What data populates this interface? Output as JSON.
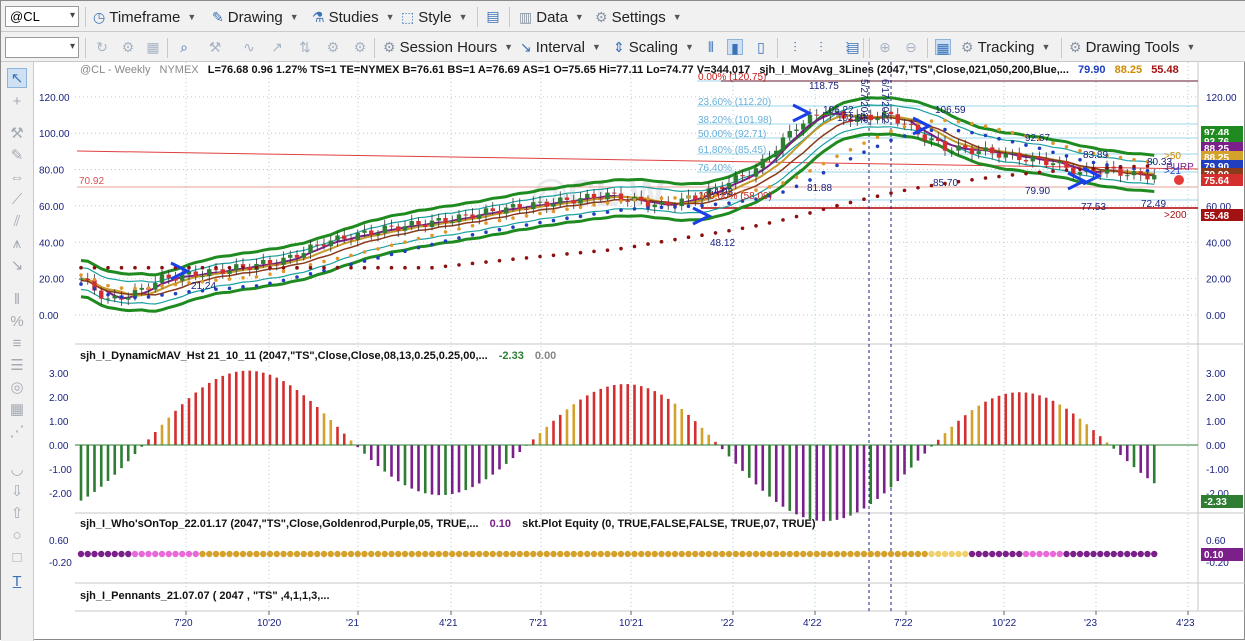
{
  "toolbar": {
    "symbol": "@CL",
    "timeframe": "Timeframe",
    "drawing": "Drawing",
    "studies": "Studies",
    "style": "Style",
    "data": "Data",
    "settings": "Settings",
    "session_hours": "Session Hours",
    "interval": "Interval",
    "scaling": "Scaling",
    "tracking": "Tracking",
    "drawing_tools": "Drawing Tools"
  },
  "chart": {
    "header_symbol": "@CL - Weekly",
    "header_exchange": "NYMEX",
    "header_quote": "L=76.68  0.96  1.27%  TS=1  TE=NYMEX  B=76.61  BS=1  A=76.69  AS=1  O=75.65  Hi=77.11  Lo=74.77  V=344,017",
    "header_study": "sjh_I_MovAvg_3Lines (2047,\"TS\",Close,021,050,200,Blue,...",
    "header_v1": "79.90",
    "header_v2": "88.25",
    "header_v3": "55.48",
    "watermark": "@CL W",
    "price_label_left": "70.92",
    "y_ticks": [
      "120.00",
      "100.00",
      "80.00",
      "60.00",
      "40.00",
      "20.00",
      "0.00"
    ],
    "price_marks": [
      "118.75",
      "106.22",
      "102.91",
      "106.59",
      "92.67",
      "85.70",
      "79.90",
      "83.89",
      "80.33",
      "72.49",
      "77.53",
      "64.93",
      "81.88",
      "48.12",
      "21.24",
      "97.48",
      "93.76",
      "88.25",
      "79.90",
      "75.64",
      "55.48"
    ],
    "fib_labels": [
      "0.00% (120.75)",
      "23.60% (112.20)",
      "38.20% (101.98)",
      "50.00% (92.71)",
      "61.80% (85.45)",
      "76.40%",
      "100.00% (58.09)"
    ],
    "ma_tags": [
      ">50",
      "PURP",
      ">21",
      ">200"
    ],
    "vertical_dates": [
      "5/27/2022",
      "6/17/2022"
    ]
  },
  "panels": {
    "p2_title": "sjh_I_DynamicMAV_Hst 21_10_11 (2047,\"TS\",Close,Close,08,13,0.25,0.25,00,...",
    "p2_v1": "-2.33",
    "p2_v2": "0.00",
    "p2_ticks": [
      "3.00",
      "2.00",
      "1.00",
      "0.00",
      "-1.00",
      "-2.00"
    ],
    "p2_badge": "-2.33",
    "p3_title": "sjh_I_Who'sOnTop_22.01.17 (2047,\"TS\",Close,Goldenrod,Purple,05, TRUE,...",
    "p3_v1": "0.10",
    "p3_study": "skt.Plot Equity (0, TRUE,FALSE,FALSE, TRUE,07, TRUE)",
    "p3_ticks": [
      "0.60",
      "-0.20"
    ],
    "p3_badge": "0.10",
    "p4_title": "sjh_I_Pennants_21.07.07 ( 2047 , \"TS\" ,4,1,1,3,..."
  },
  "xaxis": {
    "labels": [
      "7'20",
      "10'20",
      "'21",
      "4'21",
      "7'21",
      "10'21",
      "'22",
      "4'22",
      "7'22",
      "10'22",
      "'23",
      "4'23"
    ]
  },
  "colors": {
    "accent": "#3a72b8",
    "up": "#2e7d32",
    "down": "#d32f2f",
    "gold": "#d4a22c",
    "purple": "#7b1f8a",
    "dark_red": "#a31212"
  }
}
